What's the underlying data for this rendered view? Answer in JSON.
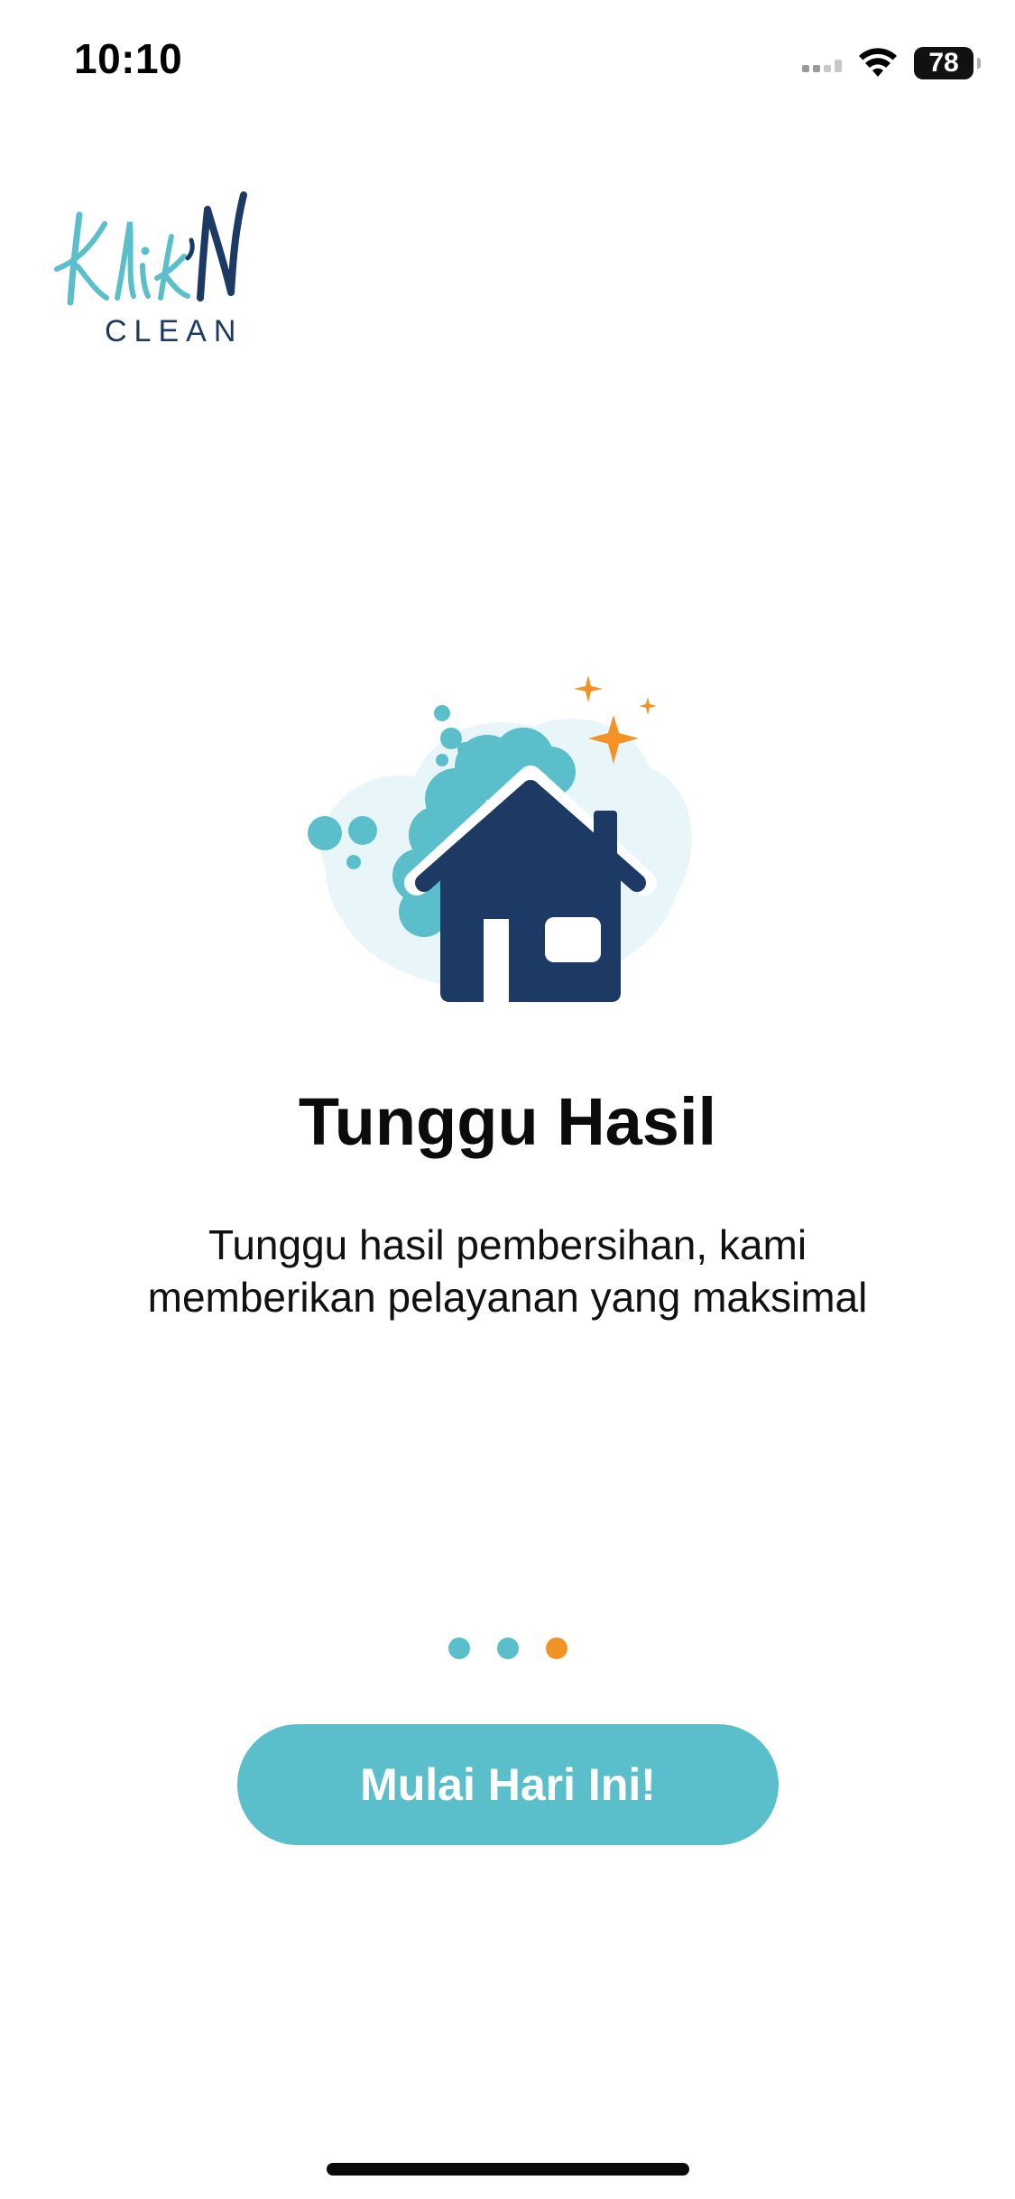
{
  "status_bar": {
    "time": "10:10",
    "battery": "78",
    "icons": [
      "cellular-signal-icon",
      "wifi-icon",
      "battery-icon"
    ]
  },
  "logo": {
    "brand_script": "Klik'N",
    "brand_sub": "CLEAN",
    "colors": {
      "teal": "#5bbfcb",
      "navy": "#1c3a63"
    }
  },
  "illustration": {
    "icon": "clean-house-icon",
    "colors": {
      "house": "#1c3a63",
      "foam": "#5bbfcb",
      "cloud": "#e8f5f9",
      "sparkle": "#f39325"
    }
  },
  "onboarding": {
    "title": "Tunggu Hasil",
    "description_line1": "Tunggu hasil pembersihan, kami",
    "description_line2": "memberikan pelayanan yang maksimal",
    "page_indicator": {
      "total": 3,
      "current": 3
    }
  },
  "cta": {
    "label": "Mulai Hari Ini!",
    "color": "#5bbfcb"
  }
}
